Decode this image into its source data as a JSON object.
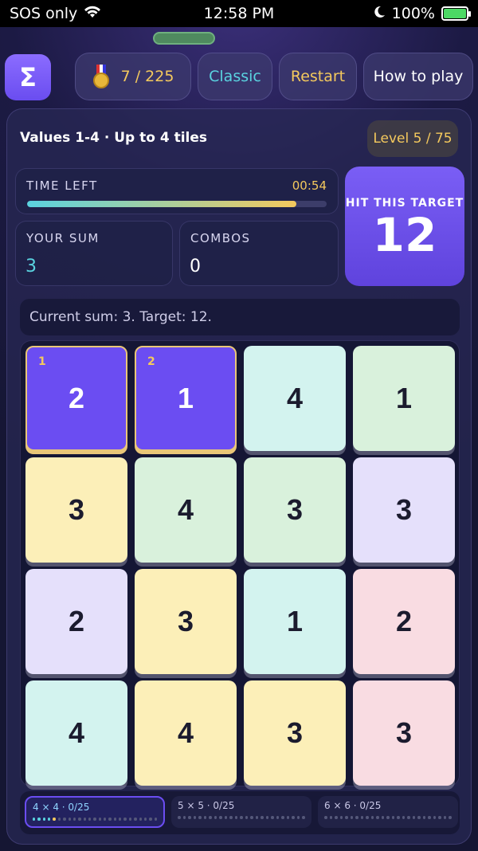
{
  "statusbar": {
    "carrier": "SOS only",
    "time": "12:58 PM",
    "battery": "100%"
  },
  "header": {
    "logo_symbol": "Σ",
    "score": "7 / 225",
    "mode": "Classic",
    "restart": "Restart",
    "how_to_play": "How to play"
  },
  "game": {
    "subtitle": "Values 1-4 · Up to 4 tiles",
    "level": "Level 5 / 75",
    "time_left_label": "TIME LEFT",
    "time_left": "00:54",
    "time_fraction": 0.9,
    "your_sum_label": "YOUR SUM",
    "your_sum": "3",
    "combos_label": "COMBOS",
    "combos": "0",
    "target_label": "HIT THIS TARGET",
    "target": "12",
    "status": "Current sum: 3. Target: 12."
  },
  "tile_colors": {
    "cyan": "#d3f3ef",
    "green": "#d9f1dc",
    "yellow": "#fcefb8",
    "lavender": "#e5e0fb",
    "pink": "#f9dce2",
    "selected": "#6b4df2"
  },
  "tiles": [
    {
      "value": "2",
      "color": "selected",
      "order": "1"
    },
    {
      "value": "1",
      "color": "selected",
      "order": "2"
    },
    {
      "value": "4",
      "color": "cyan",
      "order": ""
    },
    {
      "value": "1",
      "color": "green",
      "order": ""
    },
    {
      "value": "3",
      "color": "yellow",
      "order": ""
    },
    {
      "value": "4",
      "color": "green",
      "order": ""
    },
    {
      "value": "3",
      "color": "green",
      "order": ""
    },
    {
      "value": "3",
      "color": "lavender",
      "order": ""
    },
    {
      "value": "2",
      "color": "lavender",
      "order": ""
    },
    {
      "value": "3",
      "color": "yellow",
      "order": ""
    },
    {
      "value": "1",
      "color": "cyan",
      "order": ""
    },
    {
      "value": "2",
      "color": "pink",
      "order": ""
    },
    {
      "value": "4",
      "color": "cyan",
      "order": ""
    },
    {
      "value": "4",
      "color": "yellow",
      "order": ""
    },
    {
      "value": "3",
      "color": "yellow",
      "order": ""
    },
    {
      "value": "3",
      "color": "pink",
      "order": ""
    }
  ],
  "progress": [
    {
      "label": "4 × 4 · 0/25",
      "active": true,
      "done": 4,
      "total": 25
    },
    {
      "label": "5 × 5 · 0/25",
      "active": false,
      "done": 0,
      "total": 25
    },
    {
      "label": "6 × 6 · 0/25",
      "active": false,
      "done": 0,
      "total": 25
    }
  ]
}
